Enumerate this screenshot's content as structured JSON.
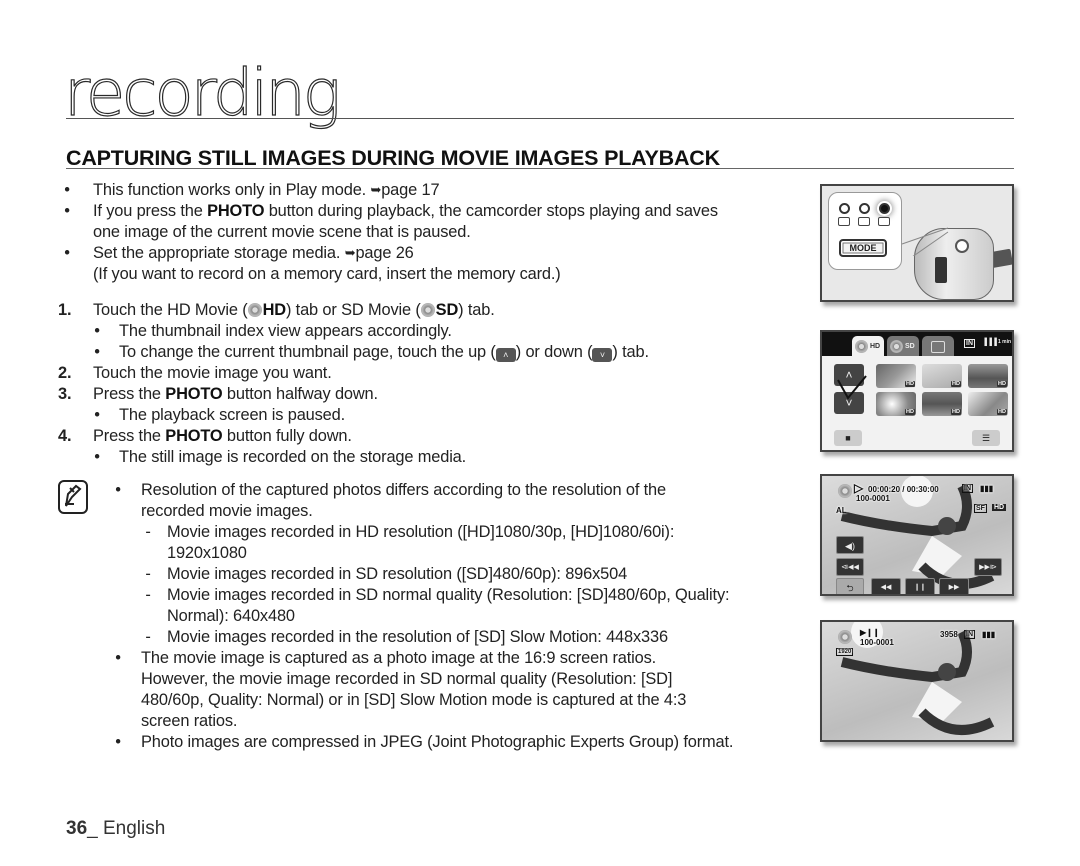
{
  "chapter": {
    "title": "recording"
  },
  "section": {
    "title": "CAPTURING STILL IMAGES DURING MOVIE IMAGES PLAYBACK"
  },
  "intro_bullets": [
    {
      "text": "This function works only in Play mode. ",
      "arrow": "➥",
      "ref": "page 17"
    },
    {
      "pre": "If you press the ",
      "bold": "PHOTO",
      "post": " button during playback, the camcorder stops playing and saves",
      "line2": "one image of the current movie scene that is paused."
    },
    {
      "text": "Set the appropriate storage media. ",
      "arrow": "➥",
      "ref": "page 26",
      "line2": "(If you want to record on a memory card, insert the memory card.)"
    }
  ],
  "steps": [
    {
      "num": "1.",
      "pre": "Touch the HD Movie (",
      "icon1": "hd-movie-icon",
      "b1": "HD",
      "mid": ") tab or SD Movie (",
      "icon2": "sd-movie-icon",
      "b2": "SD",
      "post": ") tab.",
      "subs": [
        {
          "text": "The thumbnail index view appears accordingly."
        },
        {
          "pre": "To change the current thumbnail page, touch the up (",
          "up": "˄",
          "mid": ") or down (",
          "down": "˅",
          "post": ") tab."
        }
      ]
    },
    {
      "num": "2.",
      "text": "Touch the movie image you want."
    },
    {
      "num": "3.",
      "pre": "Press the ",
      "bold": "PHOTO",
      "post": " button halfway down.",
      "subs": [
        {
          "text": "The playback screen is paused."
        }
      ]
    },
    {
      "num": "4.",
      "pre": "Press the ",
      "bold": "PHOTO",
      "post": " button fully down.",
      "subs": [
        {
          "text": "The still image is recorded on the storage media."
        }
      ]
    }
  ],
  "notes": {
    "first": {
      "line1": "Resolution of the captured photos differs according to the resolution of the",
      "line2": "recorded movie images."
    },
    "dashes": [
      {
        "line1": "Movie images recorded in HD resolution ([HD]1080/30p, [HD]1080/60i):",
        "line2": "1920x1080"
      },
      {
        "line1": "Movie images recorded in SD resolution ([SD]480/60p): 896x504"
      },
      {
        "line1": "Movie images recorded in SD normal quality (Resolution: [SD]480/60p, Quality:",
        "line2": "Normal): 640x480"
      },
      {
        "line1": "Movie images recorded in the resolution of [SD] Slow Motion: 448x336"
      }
    ],
    "second": [
      "The movie image is captured as a photo image at the 16:9 screen ratios.",
      "However, the movie image recorded in SD normal quality (Resolution: [SD]",
      "480/60p, Quality: Normal) or in [SD] Slow Motion mode is captured at the 4:3",
      "screen ratios."
    ],
    "third": "Photo images are compressed in JPEG (Joint Photographic Experts Group) format."
  },
  "figures": {
    "mode_dial": {
      "button_label": "MODE"
    },
    "thumbnail_lcd": {
      "tabs": [
        {
          "label": "HD",
          "active": true
        },
        {
          "label": "SD",
          "active": false
        },
        {
          "label": "",
          "active": false
        }
      ],
      "indicators": {
        "storage": "IN",
        "battery": "▐▐▐",
        "time": "1 min"
      },
      "page": "1/2",
      "thumb_badge": "HD",
      "thumbnails": 6
    },
    "playback": {
      "play_icon": "▷",
      "timecode": "00:00:20 / 00:30:00",
      "file": "100-0001",
      "storage": "IN",
      "quality": "SF",
      "resolution": "HD",
      "mic_label": "AL",
      "buttons": {
        "volume": "◀)",
        "prev": "⧏◀◀",
        "next": "▶▶⧐",
        "back": "⮌",
        "rew": "◀◀",
        "pause": "❙❙",
        "ff": "▶▶"
      }
    },
    "capture": {
      "pause_icon": "▶❙❙",
      "file": "100-0001",
      "count": "3958",
      "storage": "IN",
      "size": "1920"
    }
  },
  "footer": {
    "page": "36",
    "suffix": "_ English"
  }
}
